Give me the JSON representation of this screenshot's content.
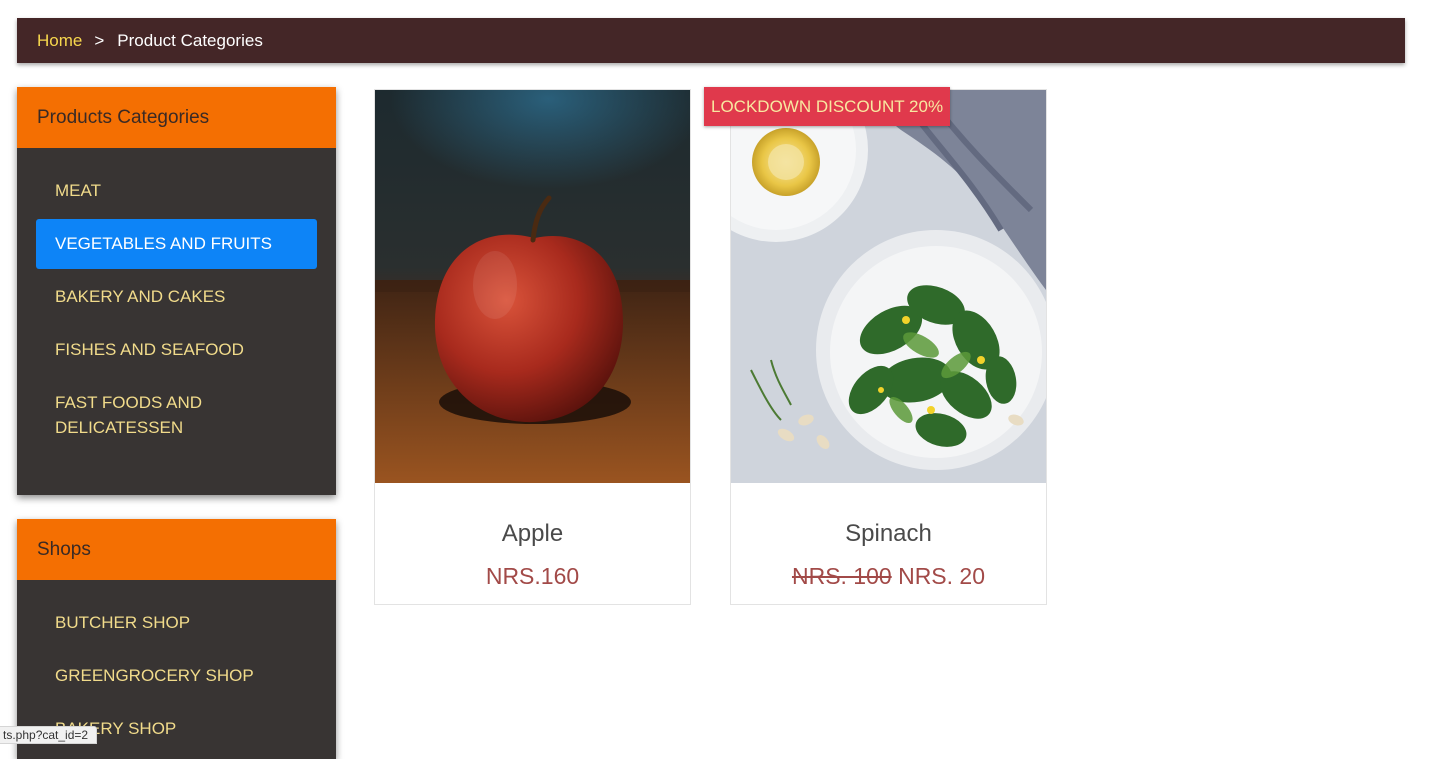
{
  "breadcrumb": {
    "home": "Home",
    "separator": ">",
    "current": "Product Categories"
  },
  "categories_panel": {
    "title": "Products Categories",
    "items": [
      {
        "label": "MEAT",
        "active": false
      },
      {
        "label": "VEGETABLES AND FRUITS",
        "active": true
      },
      {
        "label": "BAKERY AND CAKES",
        "active": false
      },
      {
        "label": "FISHES AND SEAFOOD",
        "active": false
      },
      {
        "label": "FAST FOODS AND DELICATESSEN",
        "active": false
      }
    ]
  },
  "shops_panel": {
    "title": "Shops",
    "items": [
      {
        "label": "BUTCHER SHOP"
      },
      {
        "label": "GREENGROCERY SHOP"
      },
      {
        "label": "BAKERY SHOP"
      }
    ]
  },
  "products": [
    {
      "name": "Apple",
      "price": "NRS.160",
      "image_icon": "apple-photo"
    },
    {
      "name": "Spinach",
      "old_price": "NRS. 100",
      "new_price": "NRS. 20",
      "badge": "LOCKDOWN DISCOUNT 20%",
      "image_icon": "spinach-salad-photo"
    }
  ],
  "status_bar": {
    "url": "ts.php?cat_id=2"
  },
  "colors": {
    "breadcrumb_bg": "#442627",
    "breadcrumb_link": "#f7d74d",
    "panel_header": "#f46f02",
    "panel_bg": "#383433",
    "panel_item_text": "#f1db8b",
    "active_item_bg": "#0d84f7",
    "badge_bg": "#e0394c",
    "price_color": "#a24a48"
  }
}
